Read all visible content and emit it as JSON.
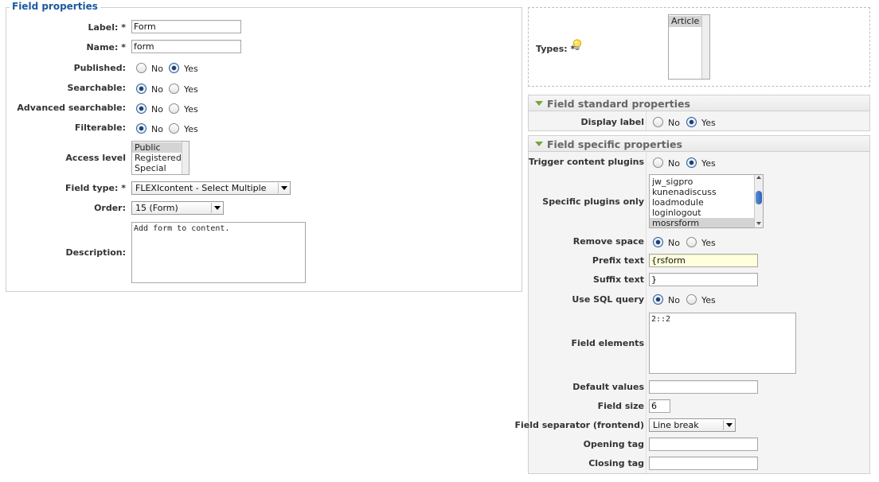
{
  "left": {
    "legend": "Field properties",
    "label": {
      "label": "Label: *",
      "value": "Form"
    },
    "name": {
      "label": "Name: *",
      "value": "form"
    },
    "published": {
      "label": "Published:",
      "no": "No",
      "yes": "Yes",
      "selected": "Yes"
    },
    "searchable": {
      "label": "Searchable:",
      "no": "No",
      "yes": "Yes",
      "selected": "No"
    },
    "advanced_searchable": {
      "label": "Advanced searchable:",
      "no": "No",
      "yes": "Yes",
      "selected": "No"
    },
    "filterable": {
      "label": "Filterable:",
      "no": "No",
      "yes": "Yes",
      "selected": "No"
    },
    "access_level": {
      "label": "Access level",
      "options": [
        "Public",
        "Registered",
        "Special"
      ],
      "selected": "Public"
    },
    "field_type": {
      "label": "Field type: *",
      "value": "FLEXIcontent - Select Multiple"
    },
    "order": {
      "label": "Order:",
      "value": "15 (Form)"
    },
    "description": {
      "label": "Description:",
      "value": "Add form to content."
    }
  },
  "types": {
    "label": "Types: *",
    "options": [
      "Article"
    ],
    "selected": "Article"
  },
  "standard": {
    "title": "Field standard properties",
    "display_label": {
      "label": "Display label",
      "no": "No",
      "yes": "Yes",
      "selected": "Yes"
    }
  },
  "specific": {
    "title": "Field specific properties",
    "trigger_content_plugins": {
      "label": "Trigger content plugins",
      "no": "No",
      "yes": "Yes",
      "selected": "Yes"
    },
    "specific_plugins_only": {
      "label": "Specific plugins only",
      "options": [
        "jw_sigpro",
        "kunenadiscuss",
        "loadmodule",
        "loginlogout",
        "mosrsform"
      ],
      "selected": "mosrsform"
    },
    "remove_space": {
      "label": "Remove space",
      "no": "No",
      "yes": "Yes",
      "selected": "No"
    },
    "prefix_text": {
      "label": "Prefix text",
      "value": "{rsform"
    },
    "suffix_text": {
      "label": "Suffix text",
      "value": "}"
    },
    "use_sql_query": {
      "label": "Use SQL query",
      "no": "No",
      "yes": "Yes",
      "selected": "No"
    },
    "field_elements": {
      "label": "Field elements",
      "value": "2::2"
    },
    "default_values": {
      "label": "Default values",
      "value": ""
    },
    "field_size": {
      "label": "Field size",
      "value": "6"
    },
    "field_separator": {
      "label": "Field separator (frontend)",
      "value": "Line break"
    },
    "opening_tag": {
      "label": "Opening tag",
      "value": ""
    },
    "closing_tag": {
      "label": "Closing tag",
      "value": ""
    }
  },
  "colors": {
    "legend": "#1b5a9c",
    "panel_title": "#666666",
    "triangle": "#74a83c",
    "highlight_input": "#ffffdd"
  },
  "icons": {
    "types_hint": "lightbulb-icon",
    "panel_toggle": "triangle-down-icon"
  }
}
